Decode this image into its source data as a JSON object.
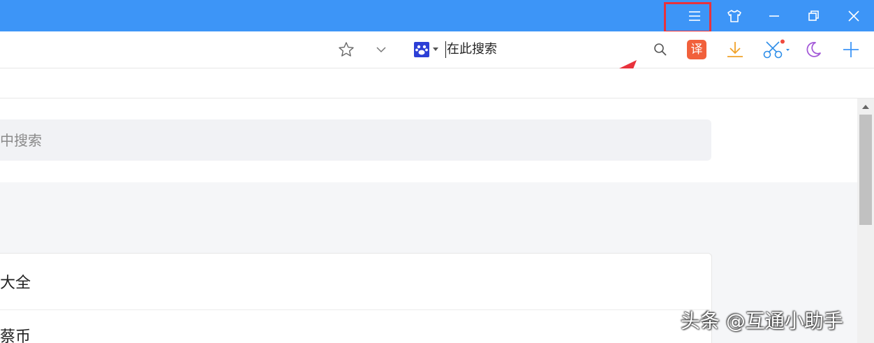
{
  "titlebar": {
    "color": "#3d95f7",
    "buttons": {
      "menu_icon": "menu-icon",
      "skin_icon": "tshirt-skin-icon",
      "minimize_icon": "minimize-icon",
      "restore_icon": "restore-icon",
      "close_icon": "close-icon"
    },
    "highlight_color": "#e8323c"
  },
  "toolbar": {
    "bookmark_icon": "star-icon",
    "dropdown_icon": "chevron-down-icon",
    "search_engine_icon": "baidu-paw-icon",
    "search_placeholder": "在此搜索",
    "search_button_icon": "search-icon",
    "translate_label": "译",
    "download_icon": "download-icon",
    "screenshot_icon": "scissors-icon",
    "night_mode_icon": "moon-icon",
    "new_tab_icon": "plus-icon"
  },
  "content": {
    "inner_search_placeholder": "中搜索",
    "list_items": [
      "大全",
      "蔡币"
    ]
  },
  "watermark": "头条 @互通小助手"
}
